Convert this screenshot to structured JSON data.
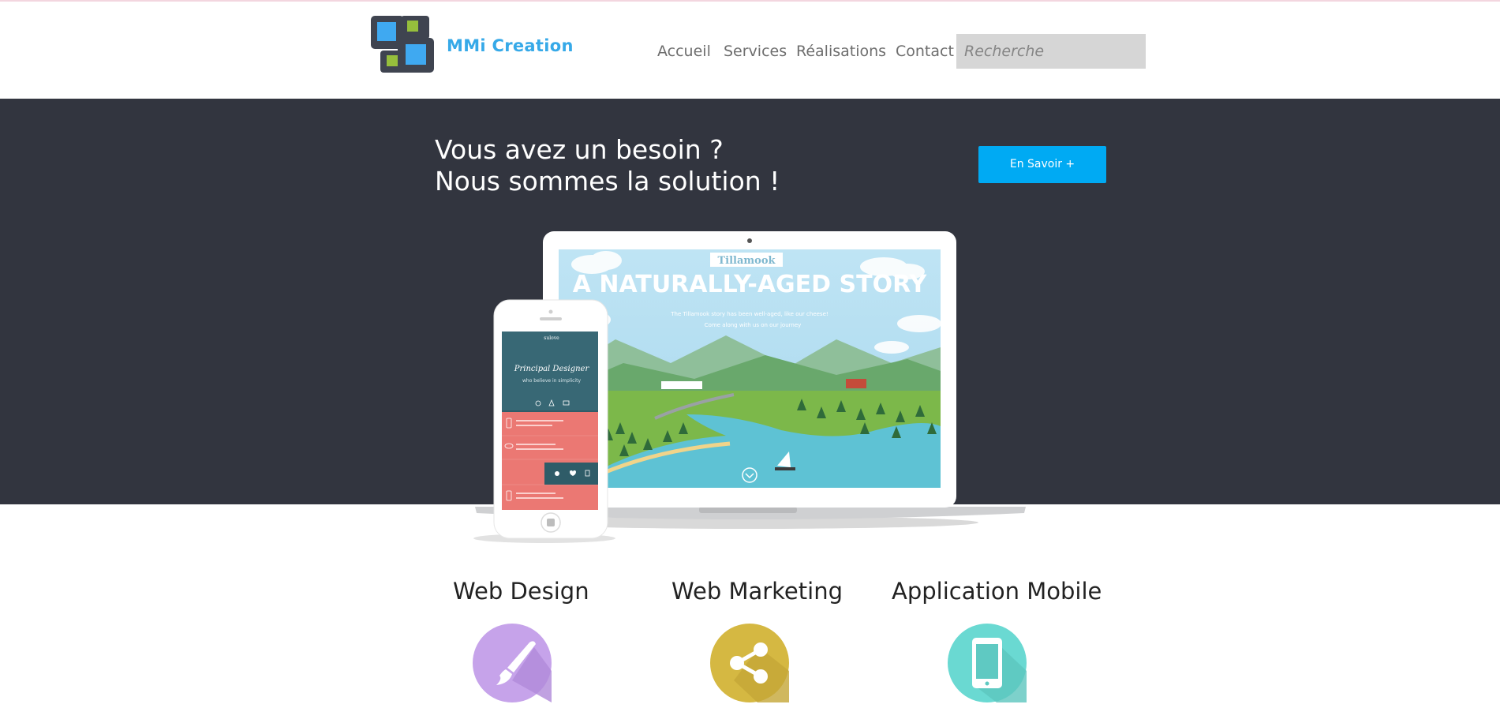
{
  "brand": {
    "name": "MMi Creation",
    "logo_icon": "brand-logo-icon"
  },
  "nav": {
    "items": [
      {
        "label": "Accueil"
      },
      {
        "label": "Services"
      },
      {
        "label": "Réalisations"
      },
      {
        "label": "Contact"
      }
    ],
    "search_placeholder": "Recherche"
  },
  "hero": {
    "line1": "Vous avez un besoin ?",
    "line2": "Nous sommes la solution !",
    "cta_label": "En Savoir +",
    "laptop_screen": {
      "badge": "Tillamook",
      "headline": "A NATURALLY-AGED STORY",
      "sub1": "The Tillamook story has been well-aged, like our cheese!",
      "sub2": "Come along with us on our journey"
    },
    "phone_screen": {
      "brand": "sulove",
      "title": "Principal Designer",
      "tagline": "who believe in simplicity"
    }
  },
  "services": [
    {
      "title": "Web Design",
      "icon": "paintbrush-icon",
      "color": "#c6a3ea"
    },
    {
      "title": "Web Marketing",
      "icon": "share-icon",
      "color": "#d5b842"
    },
    {
      "title": "Application Mobile",
      "icon": "smartphone-icon",
      "color": "#6ad9d2"
    }
  ],
  "colors": {
    "brand_blue": "#36a9e8",
    "hero_bg": "#32353f",
    "cta_bg": "#00aaf3",
    "search_bg": "#d6d6d6"
  }
}
